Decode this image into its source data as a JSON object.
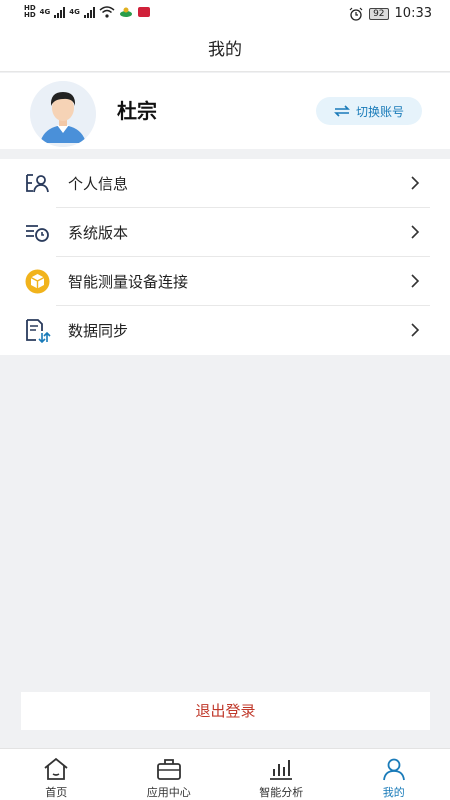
{
  "status_bar": {
    "time": "10:33",
    "battery": "92",
    "net_labels": [
      "HD",
      "HD",
      "4G",
      "4G"
    ]
  },
  "page_title": "我的",
  "profile": {
    "name": "杜宗",
    "switch_label": "切换账号"
  },
  "menu": [
    {
      "label": "个人信息",
      "icon": "person-card-icon"
    },
    {
      "label": "系统版本",
      "icon": "version-clock-icon"
    },
    {
      "label": "智能测量设备连接",
      "icon": "device-cube-icon"
    },
    {
      "label": "数据同步",
      "icon": "sync-document-icon"
    }
  ],
  "logout_label": "退出登录",
  "tabs": [
    {
      "label": "首页",
      "icon": "home-icon",
      "active": false
    },
    {
      "label": "应用中心",
      "icon": "briefcase-icon",
      "active": false
    },
    {
      "label": "智能分析",
      "icon": "bar-chart-icon",
      "active": false
    },
    {
      "label": "我的",
      "icon": "user-icon",
      "active": true
    }
  ],
  "colors": {
    "accent": "#1a7bb9",
    "logout": "#c0392b",
    "background": "#f0f1f3",
    "device_icon": "#f1b31c"
  }
}
